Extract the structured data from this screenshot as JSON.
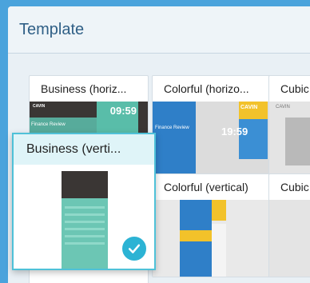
{
  "header": {
    "title": "Template"
  },
  "templates": [
    {
      "label": "Business (horiz...",
      "time": "09:59",
      "caption": "Finance Review",
      "logo": "CAVIN"
    },
    {
      "label": "Colorful (horizo...",
      "time": "19:59",
      "caption": "Finance Review",
      "logo": "CAVIN"
    },
    {
      "label": "Cubic",
      "logo": "CAVIN"
    },
    {
      "label": "Business (verti...",
      "selected": true
    },
    {
      "label": "Colorful (vertical)"
    },
    {
      "label": "Cubic"
    }
  ],
  "colors": {
    "accent": "#4fc1d8",
    "check": "#2cb3d4",
    "title": "#2f5f86"
  }
}
